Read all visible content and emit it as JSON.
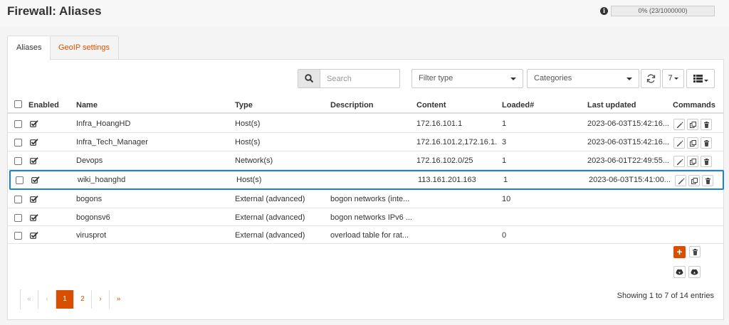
{
  "header": {
    "title": "Firewall: Aliases",
    "usage": "0% (23/1000000)"
  },
  "tabs": [
    {
      "label": "Aliases"
    },
    {
      "label": "GeoIP settings"
    }
  ],
  "toolbar": {
    "search_placeholder": "Search",
    "filter_type": "Filter type",
    "categories": "Categories",
    "rows_per_page": "7"
  },
  "columns": {
    "enabled": "Enabled",
    "name": "Name",
    "type": "Type",
    "description": "Description",
    "content": "Content",
    "loaded": "Loaded#",
    "last_updated": "Last updated",
    "commands": "Commands"
  },
  "rows": [
    {
      "enabled": true,
      "name": "Infra_HoangHD",
      "type": "Host(s)",
      "description": "",
      "content": "172.16.101.1",
      "loaded": "1",
      "last_updated": "2023-06-03T15:42:16....",
      "commands": true
    },
    {
      "enabled": true,
      "name": "Infra_Tech_Manager",
      "type": "Host(s)",
      "description": "",
      "content": "172.16.101.2,172.16.1...",
      "loaded": "3",
      "last_updated": "2023-06-03T15:42:16....",
      "commands": true
    },
    {
      "enabled": true,
      "name": "Devops",
      "type": "Network(s)",
      "description": "",
      "content": "172.16.102.0/25",
      "loaded": "1",
      "last_updated": "2023-06-01T22:49:55....",
      "commands": true
    },
    {
      "enabled": true,
      "name": "wiki_hoanghd",
      "type": "Host(s)",
      "description": "",
      "content": "113.161.201.163",
      "loaded": "1",
      "last_updated": "2023-06-03T15:41:00....",
      "commands": true,
      "selected": true
    },
    {
      "enabled": true,
      "name": "bogons",
      "type": "External (advanced)",
      "description": "bogon networks (inte...",
      "content": "",
      "loaded": "10",
      "last_updated": "",
      "commands": false
    },
    {
      "enabled": true,
      "name": "bogonsv6",
      "type": "External (advanced)",
      "description": "bogon networks IPv6 ...",
      "content": "",
      "loaded": "",
      "last_updated": "",
      "commands": false
    },
    {
      "enabled": true,
      "name": "virusprot",
      "type": "External (advanced)",
      "description": "overload table for rat...",
      "content": "",
      "loaded": "0",
      "last_updated": "",
      "commands": false
    }
  ],
  "pagination": {
    "first": "«",
    "prev": "‹",
    "pages": [
      "1",
      "2"
    ],
    "current_page": "1",
    "next": "›",
    "last": "»"
  },
  "entries_info": "Showing 1 to 7 of 14 entries",
  "colors": {
    "accent": "#d94f00",
    "selection": "#1a82d8"
  }
}
